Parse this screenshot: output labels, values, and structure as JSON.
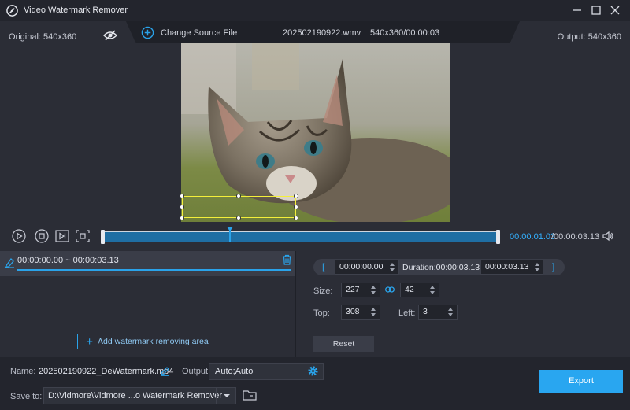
{
  "app": {
    "title": "Video Watermark Remover"
  },
  "info": {
    "original": "Original: 540x360",
    "change_source": "Change Source File",
    "file_name": "202502190922.wmv",
    "file_meta": "540x360/00:00:03",
    "output": "Output: 540x360"
  },
  "timeline": {
    "current_time": "00:00:01.03",
    "total_time": "/00:00:03.13",
    "playhead_fraction": 0.32
  },
  "clip": {
    "time_range": "00:00:00.00 ~ 00:00:03.13",
    "add_area_label": "Add watermark removing area"
  },
  "settings": {
    "range_start": "00:00:00.00",
    "duration": "Duration:00:00:03.13",
    "range_end": "00:00:03.13",
    "size_label": "Size:",
    "width": "227",
    "height": "42",
    "top_label": "Top:",
    "top": "308",
    "left_label": "Left:",
    "left": "3",
    "reset_label": "Reset"
  },
  "bottom": {
    "name_label": "Name:",
    "name_value": "202502190922_DeWatermark.mp4",
    "output_label": "Output:",
    "output_value": "Auto;Auto",
    "saveto_label": "Save to:",
    "saveto_value": "D:\\Vidmore\\Vidmore ...o Watermark Remover",
    "export_label": "Export"
  },
  "colors": {
    "accent": "#29a6f0",
    "selection": "#f4ef3a",
    "background": "#2b2d36"
  }
}
